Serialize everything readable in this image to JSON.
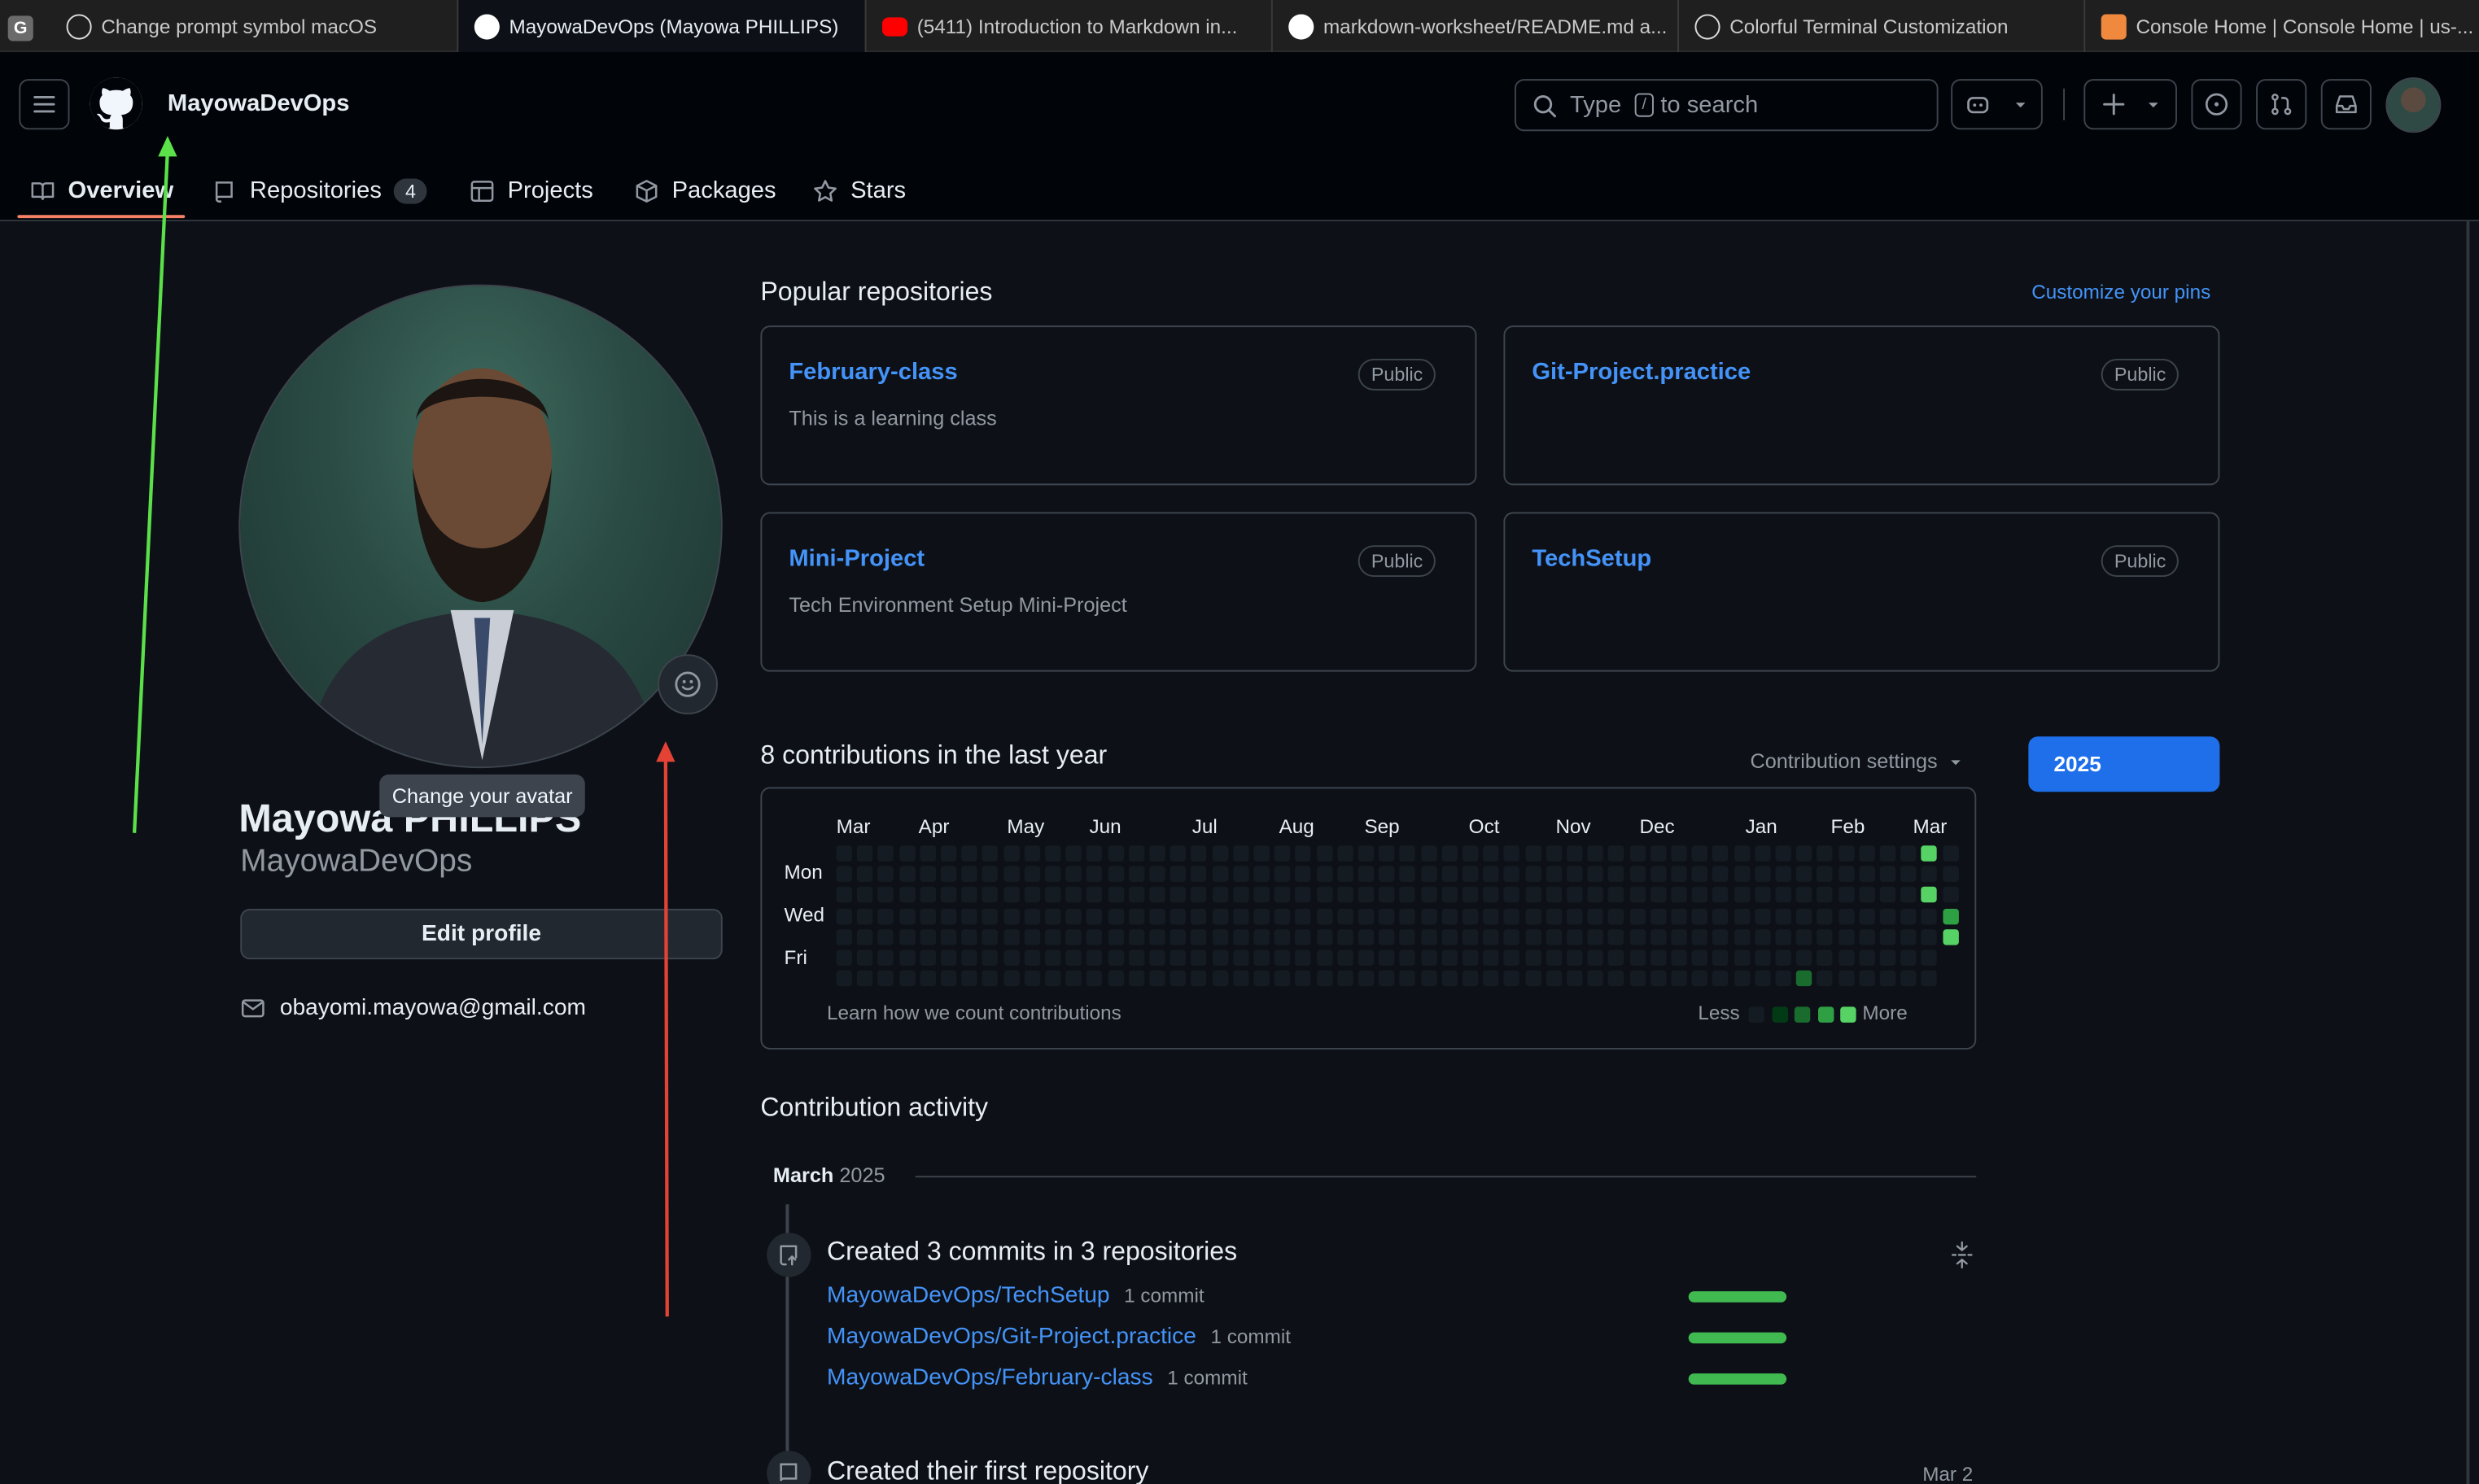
{
  "browser": {
    "tabs": [
      {
        "title": "Change prompt symbol macOS"
      },
      {
        "title": "MayowaDevOps (Mayowa PHILLIPS)"
      },
      {
        "title": "(5411) Introduction to Markdown in..."
      },
      {
        "title": "markdown-worksheet/README.md a..."
      },
      {
        "title": "Colorful Terminal Customization"
      },
      {
        "title": "Console Home | Console Home | us-..."
      }
    ],
    "group_letter": "G"
  },
  "header": {
    "username": "MayowaDevOps",
    "search_placeholder_pre": "Type",
    "search_key": "/",
    "search_placeholder_post": "to search"
  },
  "nav": {
    "overview": "Overview",
    "repositories": "Repositories",
    "repositories_count": "4",
    "projects": "Projects",
    "packages": "Packages",
    "stars": "Stars"
  },
  "profile": {
    "name": "Mayowa PHILLIPS",
    "login": "MayowaDevOps",
    "tooltip": "Change your avatar",
    "edit_button": "Edit profile",
    "email": "obayomi.mayowa@gmail.com"
  },
  "popular": {
    "title": "Popular repositories",
    "customize": "Customize your pins",
    "repos": [
      {
        "name": "February-class",
        "desc": "This is a learning class",
        "visibility": "Public"
      },
      {
        "name": "Git-Project.practice",
        "desc": "",
        "visibility": "Public"
      },
      {
        "name": "Mini-Project",
        "desc": "Tech Environment Setup Mini-Project",
        "visibility": "Public"
      },
      {
        "name": "TechSetup",
        "desc": "",
        "visibility": "Public"
      }
    ]
  },
  "contributions": {
    "title": "8 contributions in the last year",
    "settings": "Contribution settings",
    "year": "2025",
    "months": [
      "Mar",
      "Apr",
      "May",
      "Jun",
      "Jul",
      "Aug",
      "Sep",
      "Oct",
      "Nov",
      "Dec",
      "Jan",
      "Feb",
      "Mar"
    ],
    "days": [
      "Mon",
      "Wed",
      "Fri"
    ],
    "learn": "Learn how we count contributions",
    "less": "Less",
    "more": "More",
    "level_colors": [
      "#151b23",
      "#033a16",
      "#196c2e",
      "#2ea043",
      "#56d364"
    ]
  },
  "activity": {
    "title": "Contribution activity",
    "month": "March",
    "year": "2025",
    "event1": "Created 3 commits in 3 repositories",
    "commits": [
      {
        "repo": "MayowaDevOps/TechSetup",
        "count": "1 commit"
      },
      {
        "repo": "MayowaDevOps/Git-Project.practice",
        "count": "1 commit"
      },
      {
        "repo": "MayowaDevOps/February-class",
        "count": "1 commit"
      }
    ],
    "event2": "Created their first repository",
    "event2_date": "Mar 2"
  }
}
